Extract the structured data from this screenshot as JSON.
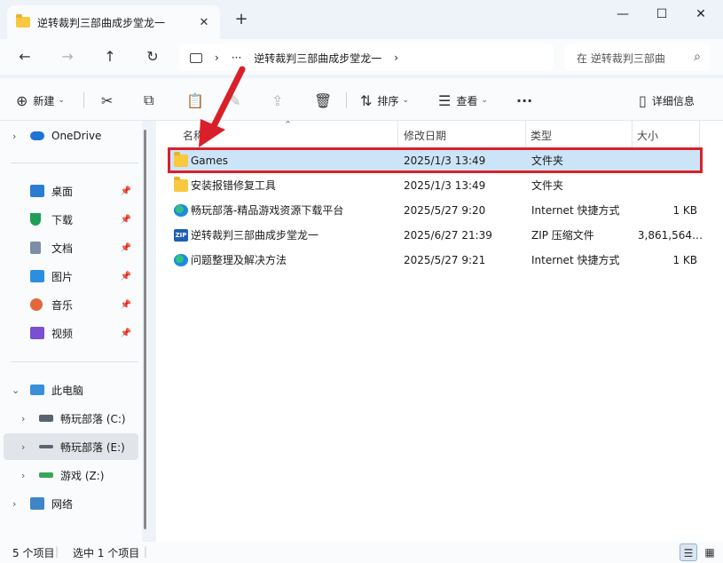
{
  "window": {
    "tab_title": "逆转裁判三部曲成步堂龙一",
    "tab_close": "✕",
    "new_tab": "+",
    "minimize": "—",
    "maximize": "☐",
    "close": "✕"
  },
  "nav": {
    "back": "←",
    "forward": "→",
    "up": "↑",
    "refresh": "↻",
    "breadcrumb_sep": "›",
    "breadcrumb_more": "···",
    "breadcrumb_current": "逆转裁判三部曲成步堂龙一",
    "breadcrumb_chevron": "›",
    "search_placeholder": "在 逆转裁判三部曲",
    "search_icon": "⌕"
  },
  "toolbar": {
    "new_label": "新建",
    "new_icon": "⊕",
    "cut_icon": "✂",
    "copy_icon": "⧉",
    "paste_icon": "📋",
    "rename_icon": "✎",
    "share_icon": "⇪",
    "delete_icon": "🗑",
    "sort_label": "排序",
    "sort_icon": "⇅",
    "view_label": "查看",
    "view_icon": "☰",
    "more_icon": "···",
    "details_label": "详细信息",
    "details_icon": "▯",
    "caret": "⌄"
  },
  "sidebar": {
    "onedrive": "OneDrive",
    "quick": [
      {
        "label": "桌面",
        "color": "#2b7cd3"
      },
      {
        "label": "下载",
        "color": "#1e9e56"
      },
      {
        "label": "文档",
        "color": "#7a8ea6"
      },
      {
        "label": "图片",
        "color": "#2b8fe0"
      },
      {
        "label": "音乐",
        "color": "#e2683c"
      },
      {
        "label": "视频",
        "color": "#7a4fd1"
      }
    ],
    "pin_icon": "📌",
    "this_pc": "此电脑",
    "drives": [
      {
        "label": "畅玩部落 (C:)"
      },
      {
        "label": "畅玩部落 (E:)"
      },
      {
        "label": "游戏 (Z:)"
      }
    ],
    "network": "网络",
    "chev_right": "›",
    "chev_down": "⌄"
  },
  "columns": {
    "name": "名称",
    "modified": "修改日期",
    "type": "类型",
    "size": "大小",
    "sort_indicator": "⌃"
  },
  "files": [
    {
      "name": "Games",
      "modified": "2025/1/3 13:49",
      "type": "文件夹",
      "size": "",
      "icon": "folder",
      "selected": true
    },
    {
      "name": "安装报错修复工具",
      "modified": "2025/1/3 13:49",
      "type": "文件夹",
      "size": "",
      "icon": "folder",
      "selected": false
    },
    {
      "name": "畅玩部落-精品游戏资源下载平台",
      "modified": "2025/5/27 9:20",
      "type": "Internet 快捷方式",
      "size": "1 KB",
      "icon": "link",
      "selected": false
    },
    {
      "name": "逆转裁判三部曲成步堂龙一",
      "modified": "2025/6/27 21:39",
      "type": "ZIP 压缩文件",
      "size": "3,861,564…",
      "icon": "zip",
      "selected": false
    },
    {
      "name": "问题整理及解决方法",
      "modified": "2025/5/27 9:21",
      "type": "Internet 快捷方式",
      "size": "1 KB",
      "icon": "link",
      "selected": false
    }
  ],
  "status": {
    "count": "5 个项目",
    "selected": "选中 1 个项目",
    "details_view_icon": "☰",
    "tiles_view_icon": "▦"
  },
  "annotation": {
    "highlight_color": "#d9202a"
  }
}
